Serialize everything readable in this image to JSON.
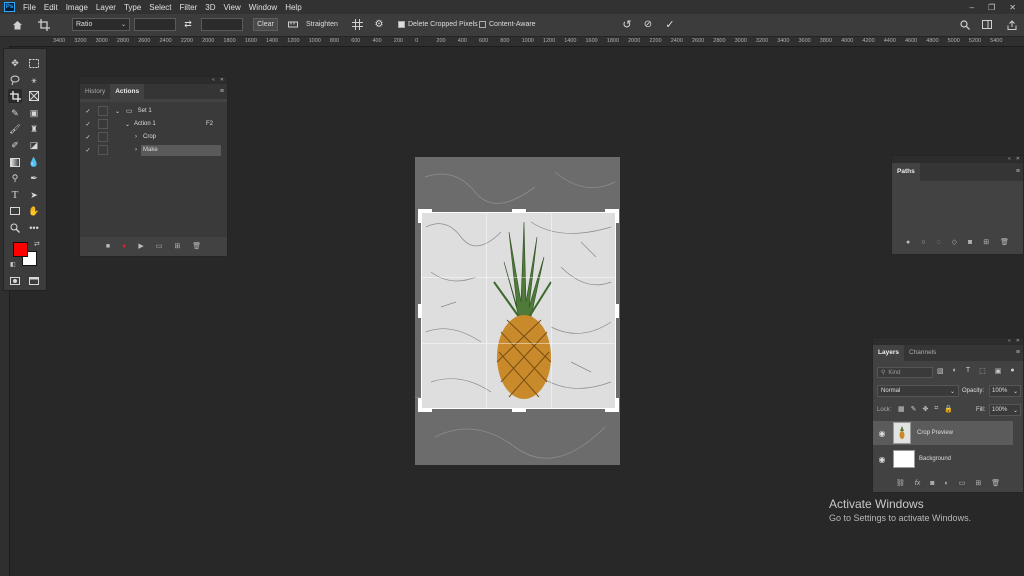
{
  "menubar": {
    "logo": "Ps",
    "items": [
      "File",
      "Edit",
      "Image",
      "Layer",
      "Type",
      "Select",
      "Filter",
      "3D",
      "View",
      "Window",
      "Help"
    ],
    "window_buttons": [
      "–",
      "❐",
      "✕"
    ]
  },
  "optbar": {
    "ratio_value": "Ratio",
    "clear_label": "Clear",
    "straighten_label": "Straighten",
    "delete_cropped_label": "Delete Cropped Pixels",
    "content_aware_label": "Content-Aware"
  },
  "ruler": {
    "ticks": [
      "3400",
      "3200",
      "3000",
      "2800",
      "2600",
      "2400",
      "2200",
      "2000",
      "1800",
      "1600",
      "1400",
      "1200",
      "1000",
      "800",
      "600",
      "400",
      "200",
      "0",
      "200",
      "400",
      "600",
      "800",
      "1000",
      "1200",
      "1400",
      "1600",
      "1800",
      "2000",
      "2200",
      "2400",
      "2600",
      "2800",
      "3000",
      "3200",
      "3400",
      "3600",
      "3800",
      "4000",
      "4200",
      "4400",
      "4600",
      "4800",
      "5000",
      "5200",
      "5400"
    ]
  },
  "colors": {
    "foreground": "#ff0000",
    "background": "#ffffff",
    "accent": "#31a8ff"
  },
  "actions_panel": {
    "tabs": [
      "History",
      "Actions"
    ],
    "rows": [
      {
        "label": "Set 1",
        "shortcut": ""
      },
      {
        "label": "Action 1",
        "shortcut": "F2"
      },
      {
        "label": "Crop",
        "shortcut": ""
      },
      {
        "label": "Make",
        "shortcut": ""
      }
    ]
  },
  "paths_panel": {
    "tab": "Paths"
  },
  "layers_panel": {
    "tabs": [
      "Layers",
      "Channels"
    ],
    "kind_placeholder": "Kind",
    "blend_mode": "Normal",
    "opacity_label": "Opacity:",
    "opacity_value": "100%",
    "lock_label": "Lock:",
    "fill_label": "Fill:",
    "fill_value": "100%",
    "layers": [
      {
        "name": "Crop Preview"
      },
      {
        "name": "Background"
      }
    ]
  },
  "watermark": {
    "title": "Activate Windows",
    "subtitle": "Go to Settings to activate Windows."
  }
}
